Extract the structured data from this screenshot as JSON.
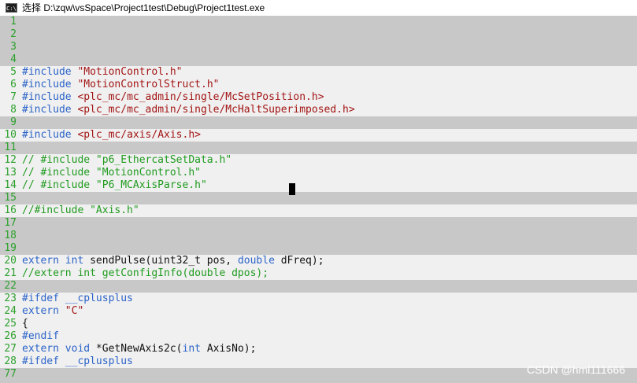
{
  "window": {
    "title": "选择 D:\\zqw\\vsSpace\\Project1test\\Debug\\Project1test.exe",
    "icon_label": "C:\\"
  },
  "lines": [
    {
      "n": "1",
      "hl": false,
      "segs": []
    },
    {
      "n": "2",
      "hl": false,
      "segs": []
    },
    {
      "n": "3",
      "hl": false,
      "segs": []
    },
    {
      "n": "4",
      "hl": false,
      "segs": []
    },
    {
      "n": "5",
      "hl": true,
      "segs": [
        [
          "kw",
          "#include "
        ],
        [
          "str",
          "\"MotionControl.h\""
        ]
      ]
    },
    {
      "n": "6",
      "hl": true,
      "segs": [
        [
          "kw",
          "#include "
        ],
        [
          "str",
          "\"MotionControlStruct.h\""
        ]
      ]
    },
    {
      "n": "7",
      "hl": true,
      "segs": [
        [
          "kw",
          "#include "
        ],
        [
          "str",
          "<plc_mc/mc_admin/single/McSetPosition.h>"
        ]
      ]
    },
    {
      "n": "8",
      "hl": true,
      "segs": [
        [
          "kw",
          "#include "
        ],
        [
          "str",
          "<plc_mc/mc_admin/single/McHaltSuperimposed.h>"
        ]
      ]
    },
    {
      "n": "9",
      "hl": false,
      "segs": []
    },
    {
      "n": "10",
      "hl": true,
      "segs": [
        [
          "kw",
          "#include "
        ],
        [
          "str",
          "<plc_mc/axis/Axis.h>"
        ]
      ]
    },
    {
      "n": "11",
      "hl": false,
      "segs": []
    },
    {
      "n": "12",
      "hl": true,
      "segs": [
        [
          "cmt",
          "// #include \"p6_EthercatSetData.h\""
        ]
      ]
    },
    {
      "n": "13",
      "hl": true,
      "segs": [
        [
          "cmt",
          "// #include \"MotionControl.h\""
        ]
      ]
    },
    {
      "n": "14",
      "hl": true,
      "segs": [
        [
          "cmt",
          "// #include \"P6_MCAxisParse.h\""
        ]
      ]
    },
    {
      "n": "15",
      "hl": false,
      "segs": []
    },
    {
      "n": "16",
      "hl": true,
      "segs": [
        [
          "cmt",
          "//#include \"Axis.h\""
        ]
      ]
    },
    {
      "n": "17",
      "hl": false,
      "segs": []
    },
    {
      "n": "18",
      "hl": false,
      "segs": []
    },
    {
      "n": "19",
      "hl": false,
      "segs": []
    },
    {
      "n": "20",
      "hl": true,
      "segs": [
        [
          "kw",
          "extern int "
        ],
        [
          "pln",
          "sendPulse(uint32_t pos, "
        ],
        [
          "kw",
          "double "
        ],
        [
          "pln",
          "dFreq);"
        ]
      ]
    },
    {
      "n": "21",
      "hl": true,
      "segs": [
        [
          "cmt",
          "//extern int getConfigInfo(double dpos);"
        ]
      ]
    },
    {
      "n": "22",
      "hl": false,
      "segs": []
    },
    {
      "n": "23",
      "hl": true,
      "segs": [
        [
          "kw",
          "#ifdef __cplusplus"
        ]
      ]
    },
    {
      "n": "24",
      "hl": true,
      "segs": [
        [
          "kw",
          "extern "
        ],
        [
          "str",
          "\"C\""
        ]
      ]
    },
    {
      "n": "25",
      "hl": true,
      "segs": [
        [
          "pln",
          "{"
        ]
      ]
    },
    {
      "n": "26",
      "hl": true,
      "segs": [
        [
          "kw",
          "#endif"
        ]
      ]
    },
    {
      "n": "27",
      "hl": true,
      "segs": [
        [
          "kw",
          "extern void "
        ],
        [
          "pln",
          "*GetNewAxis2c("
        ],
        [
          "kw",
          "int "
        ],
        [
          "pln",
          "AxisNo);"
        ]
      ]
    },
    {
      "n": "28",
      "hl": true,
      "segs": [
        [
          "kw",
          "#ifdef __cplusplus"
        ]
      ]
    },
    {
      "n": "77",
      "hl": false,
      "segs": []
    }
  ],
  "watermark": "CSDN @hml111666",
  "colors": {
    "keyword": "#2b63c8",
    "string": "#a31515",
    "comment": "#1f9b1f",
    "line_number": "#2ca02c",
    "background": "#c8c8c8",
    "highlight": "#f0f0f0"
  }
}
